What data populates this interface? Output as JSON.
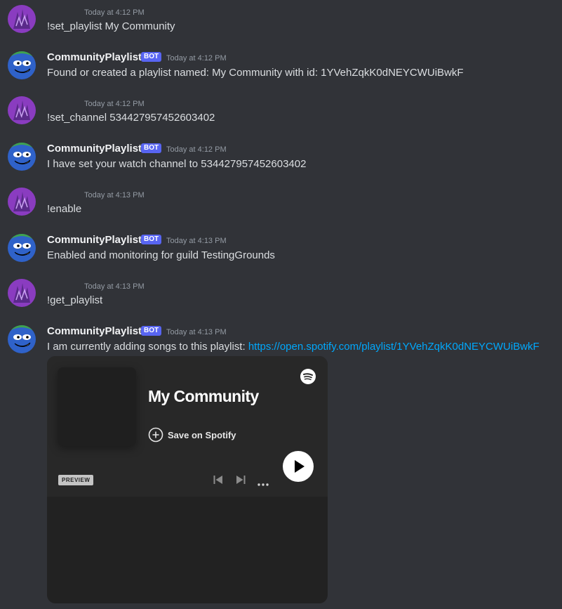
{
  "colors": {
    "background": "#313338",
    "bot_tag": "#5865f2",
    "link": "#00a8fc",
    "user_avatar": "#8a3cc0",
    "bot_avatar": "#2f62c9"
  },
  "messages": [
    {
      "type": "user",
      "timestamp": "Today at 4:12 PM",
      "text": "!set_playlist My Community"
    },
    {
      "type": "bot",
      "author": "CommunityPlaylist",
      "tag": "BOT",
      "timestamp": "Today at 4:12 PM",
      "text": "Found or created a playlist named: My Community with id: 1YVehZqkK0dNEYCWUiBwkF"
    },
    {
      "type": "user",
      "timestamp": "Today at 4:12 PM",
      "text": "!set_channel 534427957452603402"
    },
    {
      "type": "bot",
      "author": "CommunityPlaylist",
      "tag": "BOT",
      "timestamp": "Today at 4:12 PM",
      "text": "I have set your watch channel to 534427957452603402"
    },
    {
      "type": "user",
      "timestamp": "Today at 4:13 PM",
      "text": "!enable"
    },
    {
      "type": "bot",
      "author": "CommunityPlaylist",
      "tag": "BOT",
      "timestamp": "Today at 4:13 PM",
      "text": "Enabled and monitoring for guild TestingGrounds"
    },
    {
      "type": "user",
      "timestamp": "Today at 4:13 PM",
      "text": "!get_playlist"
    },
    {
      "type": "bot",
      "author": "CommunityPlaylist",
      "tag": "BOT",
      "timestamp": "Today at 4:13 PM",
      "text": "I am currently adding songs to this playlist: ",
      "link": "https://open.spotify.com/playlist/1YVehZqkK0dNEYCWUiBwkF"
    }
  ],
  "embed": {
    "title": "My Community",
    "save_label": "Save on Spotify",
    "preview_label": "PREVIEW",
    "icons": [
      "spotify-icon",
      "add-circle-icon",
      "previous-track-icon",
      "next-track-icon",
      "more-icon",
      "play-icon"
    ]
  }
}
